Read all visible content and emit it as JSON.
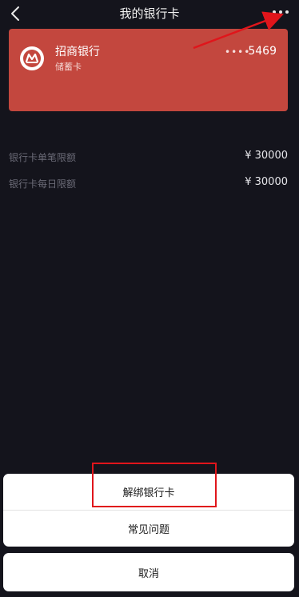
{
  "header": {
    "title": "我的银行卡",
    "back_icon": "chevron-left-icon",
    "more_icon": "more-dots-icon"
  },
  "card": {
    "bank_name": "招商银行",
    "card_type": "储蓄卡",
    "masked_dots": "••••",
    "last4": "5469",
    "background_color": "#c3473e",
    "logo_icon": "cmb-bank-logo-icon"
  },
  "limits": [
    {
      "label": "银行卡单笔限额",
      "value": "¥ 30000"
    },
    {
      "label": "银行卡每日限额",
      "value": "¥ 30000"
    }
  ],
  "action_sheet": {
    "items": [
      {
        "label": "解绑银行卡"
      },
      {
        "label": "常见问题"
      }
    ],
    "cancel_label": "取消"
  },
  "annotation": {
    "color": "#e0151b"
  }
}
